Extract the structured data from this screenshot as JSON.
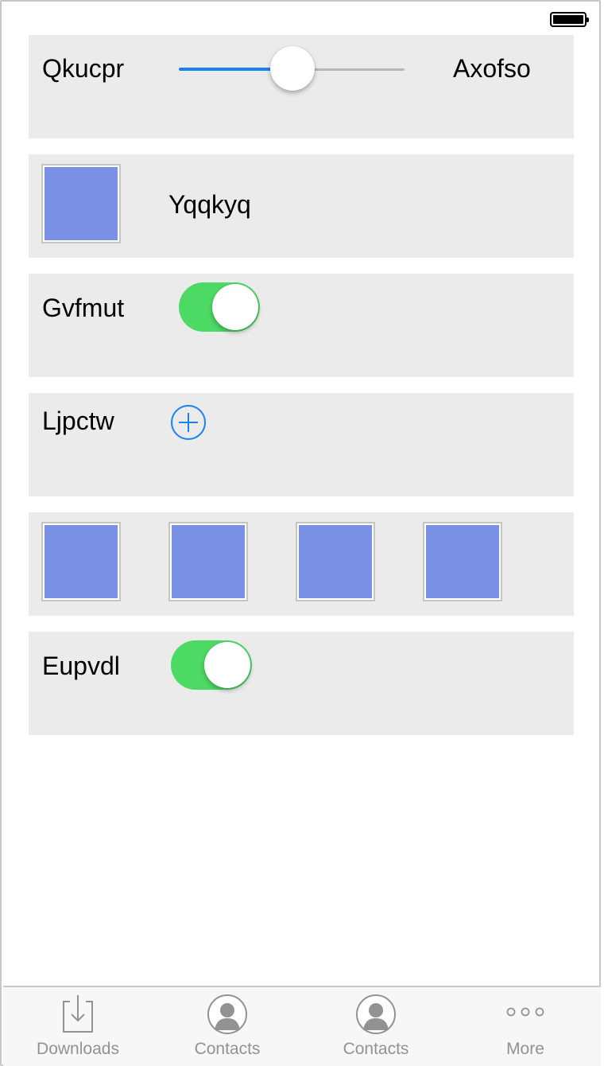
{
  "status_bar": {
    "battery_icon": "battery-full-icon"
  },
  "rows": {
    "slider_row": {
      "min_label": "Qkucpr",
      "max_label": "Axofso",
      "value_fraction": 0.49,
      "accent": "#1a82f0"
    },
    "image_row": {
      "label": "Yqqkyq"
    },
    "switch_row_1": {
      "label": "Gvfmut",
      "on": true,
      "on_color": "#4cd964"
    },
    "add_row": {
      "label": "Ljpctw",
      "icon": "add-circle-icon"
    },
    "image_grid_row": {
      "count": 4,
      "image_color": "#7a90e4"
    },
    "switch_row_2": {
      "label": "Eupvdl",
      "on": true
    }
  },
  "tab_bar": {
    "tabs": [
      {
        "label": "Downloads",
        "icon": "download-tray-icon"
      },
      {
        "label": "Contacts",
        "icon": "contact-silhouette-icon"
      },
      {
        "label": "Contacts",
        "icon": "contact-silhouette-icon"
      },
      {
        "label": "More",
        "icon": "more-dots-icon"
      }
    ]
  }
}
